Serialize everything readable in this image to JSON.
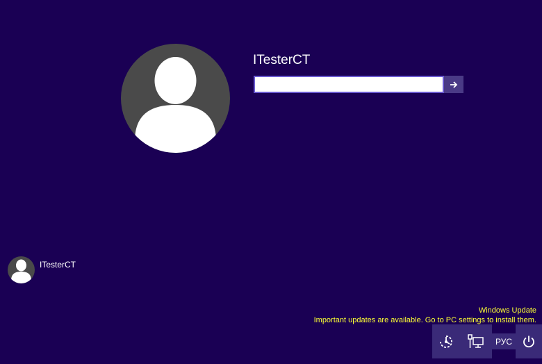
{
  "login": {
    "username": "ITesterCT",
    "password_value": "",
    "password_placeholder": ""
  },
  "users": [
    {
      "name": "ITesterCT"
    }
  ],
  "update_notice": {
    "title": "Windows Update",
    "message": "Important updates are available. Go to PC settings to install them."
  },
  "tray": {
    "language": "РУС"
  },
  "icons": {
    "submit": "arrow-right-icon",
    "ease_of_access": "ease-of-access-icon",
    "network": "network-icon",
    "power": "power-icon",
    "avatar": "user-avatar-icon"
  },
  "colors": {
    "background": "#1a0054",
    "avatar": "#4a4a4a",
    "tray": "#3a2a78",
    "notice_text": "#ffff33",
    "input_border": "#6a5ad0"
  }
}
